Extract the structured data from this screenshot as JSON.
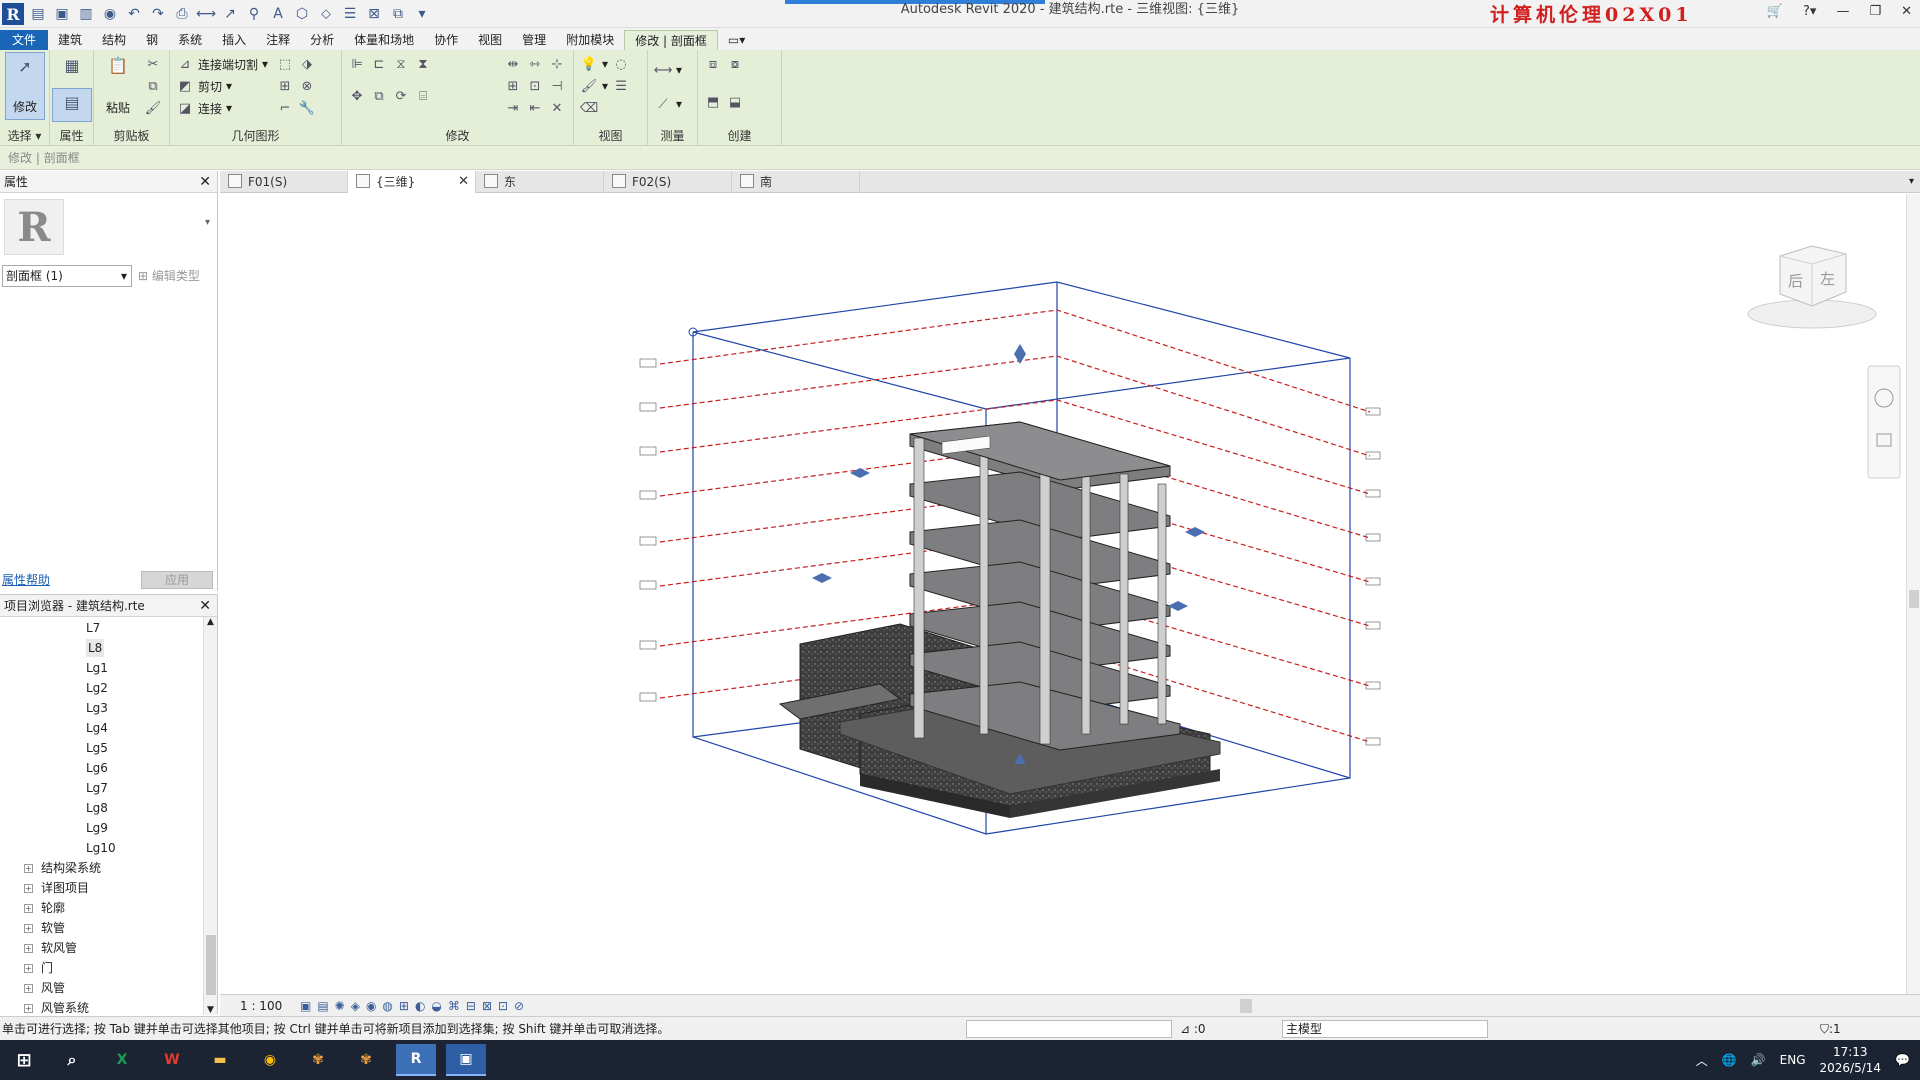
{
  "window": {
    "title": "Autodesk Revit 2020 - 建筑结构.rte - 三维视图: {三维}",
    "watermark": "计算机伦理02X01"
  },
  "ribbon": {
    "tabs": [
      "文件",
      "建筑",
      "结构",
      "钢",
      "系统",
      "插入",
      "注释",
      "分析",
      "体量和场地",
      "协作",
      "视图",
      "管理",
      "附加模块",
      "修改 | 剖面框"
    ],
    "active_tab": "修改 | 剖面框",
    "buttons": {
      "modify": "修改",
      "paste": "粘贴",
      "join_cut": "连接端切割",
      "cut": "剪切",
      "join": "连接"
    },
    "panels": [
      "选择",
      "属性",
      "剪贴板",
      "几何图形",
      "修改",
      "视图",
      "测量",
      "创建"
    ]
  },
  "context_bar": "修改 | 剖面框",
  "properties": {
    "title": "属性",
    "type_selector": "剖面框 (1)",
    "edit_type": "编辑类型",
    "help_link": "属性帮助",
    "apply": "应用"
  },
  "browser": {
    "title": "项目浏览器 - 建筑结构.rte",
    "levels": [
      "L7",
      "L8",
      "Lg1",
      "Lg2",
      "Lg3",
      "Lg4",
      "Lg5",
      "Lg6",
      "Lg7",
      "Lg8",
      "Lg9",
      "Lg10"
    ],
    "selected": "L8",
    "groups": [
      "结构梁系统",
      "详图项目",
      "轮廓",
      "软管",
      "软风管",
      "门",
      "风管",
      "风管系统"
    ]
  },
  "view_tabs": [
    {
      "label": "F01(S)",
      "active": false
    },
    {
      "label": "{三维}",
      "active": true
    },
    {
      "label": "东",
      "active": false
    },
    {
      "label": "F02(S)",
      "active": false
    },
    {
      "label": "南",
      "active": false
    }
  ],
  "view_control": {
    "scale": "1 : 100"
  },
  "status": {
    "hint": "单击可进行选择; 按 Tab 键并单击可选择其他项目; 按 Ctrl 键并单击可将新项目添加到选择集; 按 Shift 键并单击可取消选择。",
    "sel_count": ":0",
    "model": "主模型",
    "filter": ":1"
  },
  "taskbar": {
    "time": "17:13",
    "date": "2026/5/14",
    "lang": "ENG",
    "apps": [
      "Excel",
      "WPS",
      "Explorer",
      "Chrome",
      "App",
      "App",
      "Revit",
      "Other"
    ]
  },
  "viewcube": {
    "face_left": "后",
    "face_right": "左"
  },
  "colors": {
    "file_tab": "#1b65b7",
    "ribbon": "#e5efd8",
    "section_box": "#2046a8",
    "level_line": "#c81e1e",
    "taskbar": "#1c2433"
  }
}
